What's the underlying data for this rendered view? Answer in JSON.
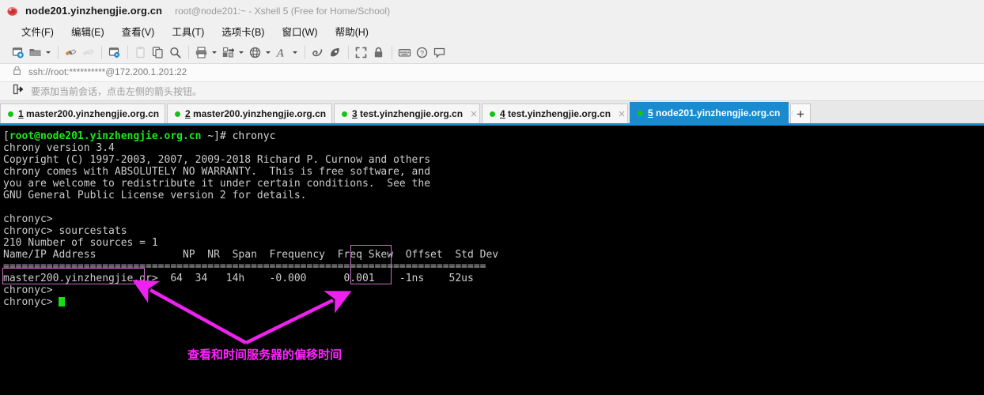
{
  "window": {
    "title": "node201.yinzhengjie.org.cn",
    "subtitle": "root@node201:~ - Xshell 5 (Free for Home/School)",
    "app_icon": "xshell-icon"
  },
  "menu": {
    "items": [
      {
        "label": "文件(F)",
        "name": "menu-file"
      },
      {
        "label": "编辑(E)",
        "name": "menu-edit"
      },
      {
        "label": "查看(V)",
        "name": "menu-view"
      },
      {
        "label": "工具(T)",
        "name": "menu-tools"
      },
      {
        "label": "选项卡(B)",
        "name": "menu-tabs"
      },
      {
        "label": "窗口(W)",
        "name": "menu-window"
      },
      {
        "label": "帮助(H)",
        "name": "menu-help"
      }
    ]
  },
  "toolbar": {
    "icons": [
      "new-session-icon",
      "open-folder-icon",
      "connect-icon",
      "disconnect-icon",
      "session-properties-icon",
      "paste-page-icon",
      "copy-icon",
      "find-icon",
      "print-icon",
      "transfer-icon",
      "globe-icon",
      "font-icon",
      "sftp-icon",
      "script-icon",
      "fullscreen-icon",
      "lock-icon",
      "keyboard-icon",
      "help-icon",
      "comment-icon"
    ]
  },
  "address_bar": {
    "icon": "lock-icon",
    "value": "ssh://root:**********@172.200.1.201:22"
  },
  "hint_bar": {
    "icon": "add-session-arrow-icon",
    "text": "要添加当前会话，点击左侧的箭头按钮。"
  },
  "tabs": {
    "active_index": 4,
    "add_label": "+",
    "close_glyph": "×",
    "items": [
      {
        "num": "1",
        "label": " master200.yinzhengjie.org.cn",
        "status": "connected"
      },
      {
        "num": "2",
        "label": " master200.yinzhengjie.org.cn",
        "status": "connected"
      },
      {
        "num": "3",
        "label": " test.yinzhengjie.org.cn",
        "status": "connected"
      },
      {
        "num": "4",
        "label": " test.yinzhengjie.org.cn",
        "status": "connected"
      },
      {
        "num": "5",
        "label": " node201.yinzhengjie.org.cn",
        "status": "connected"
      }
    ]
  },
  "terminal": {
    "prompt_user_host": "root@node201.yinzhengjie.org.cn",
    "prompt_open": "[",
    "prompt_tail": " ~]# ",
    "first_command": "chronyc",
    "lines": [
      "chrony version 3.4",
      "Copyright (C) 1997-2003, 2007, 2009-2018 Richard P. Curnow and others",
      "chrony comes with ABSOLUTELY NO WARRANTY.  This is free software, and",
      "you are welcome to redistribute it under certain conditions.  See the",
      "GNU General Public License version 2 for details.",
      "",
      "chronyc>",
      "chronyc> sourcestats",
      "210 Number of sources = 1",
      "Name/IP Address              NP  NR  Span  Frequency  Freq Skew  Offset  Std Dev",
      "==============================================================================",
      "master200.yinzhengjie.or>  64  34   14h    -0.000      0.001    -1ns    52us",
      "chronyc>"
    ],
    "last_prompt": "chronyc> "
  },
  "sourcestats": {
    "headers": [
      "Name/IP Address",
      "NP",
      "NR",
      "Span",
      "Frequency",
      "Freq Skew",
      "Offset",
      "Std Dev"
    ],
    "rows": [
      {
        "name": "master200.yinzhengjie.or>",
        "np": "64",
        "nr": "34",
        "span": "14h",
        "frequency": "-0.000",
        "freq_skew": "0.001",
        "offset": "-1ns",
        "std_dev": "52us"
      }
    ],
    "count_line": "210 Number of sources = 1"
  },
  "annotation": {
    "text": "查看和时间服务器的偏移时间",
    "color": "#ff22ff",
    "box_color": "#c86ec8",
    "highlight_targets": [
      "source-name-cell",
      "offset-column"
    ]
  }
}
